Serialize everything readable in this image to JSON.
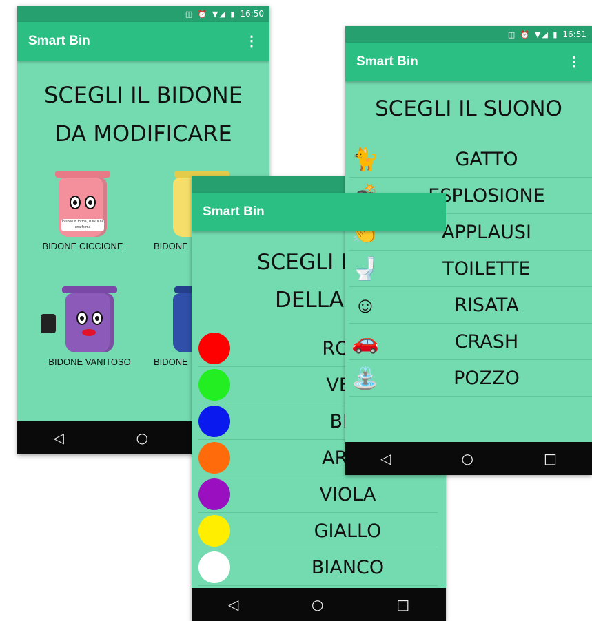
{
  "phones": {
    "bins": {
      "status_time": "16:50",
      "app_title": "Smart Bin",
      "heading_line1": "SCEGLI IL BIDONE",
      "heading_line2": "DA MODIFICARE",
      "bin_items": [
        {
          "label": "BIDONE CICCIONE",
          "color": "#f3909c",
          "shirt_text": "Io sono in forma, TONDO è una forma"
        },
        {
          "label": "BIDONE",
          "color": "#f5df6a"
        },
        {
          "label": "BIDONE VANITOSO",
          "color": "#8c5ab8"
        },
        {
          "label": "BIDONE",
          "color": "#2f4fa8"
        }
      ],
      "nav": {
        "back": "◁",
        "home": "○",
        "recent": "□"
      }
    },
    "colors": {
      "app_title": "Smart Bin",
      "heading_line1": "SCEGLI IL C",
      "heading_line2": "DELLA L",
      "items": [
        {
          "label": "ROSS",
          "swatch": "#ff0000"
        },
        {
          "label": "VERI",
          "swatch": "#22ee22"
        },
        {
          "label": "BLU",
          "swatch": "#0a1aee"
        },
        {
          "label": "ARAN",
          "swatch": "#ff6b0a"
        },
        {
          "label": "VIOLA",
          "swatch": "#9a0fc0"
        },
        {
          "label": "GIALLO",
          "swatch": "#ffee00"
        },
        {
          "label": "BIANCO",
          "swatch": "#ffffff"
        }
      ],
      "nav": {
        "back": "◁",
        "home": "○",
        "recent": "□"
      }
    },
    "sounds": {
      "status_time": "16:51",
      "app_title": "Smart Bin",
      "heading": "SCEGLI IL SUONO",
      "items": [
        {
          "label": "GATTO",
          "icon": "cat-icon",
          "glyph": "🐈"
        },
        {
          "label": "ESPLOSIONE",
          "icon": "bomb-icon",
          "glyph": "💣"
        },
        {
          "label": "APPLAUSI",
          "icon": "clapping-hands-icon",
          "glyph": "👏"
        },
        {
          "label": "TOILETTE",
          "icon": "toilet-icon",
          "glyph": "🚽"
        },
        {
          "label": "RISATA",
          "icon": "devil-laugh-icon",
          "glyph": "☺"
        },
        {
          "label": "CRASH",
          "icon": "car-crash-icon",
          "glyph": "🚗"
        },
        {
          "label": "POZZO",
          "icon": "well-icon",
          "glyph": "⛲"
        }
      ],
      "nav": {
        "back": "◁",
        "home": "○",
        "recent": "□"
      }
    }
  }
}
